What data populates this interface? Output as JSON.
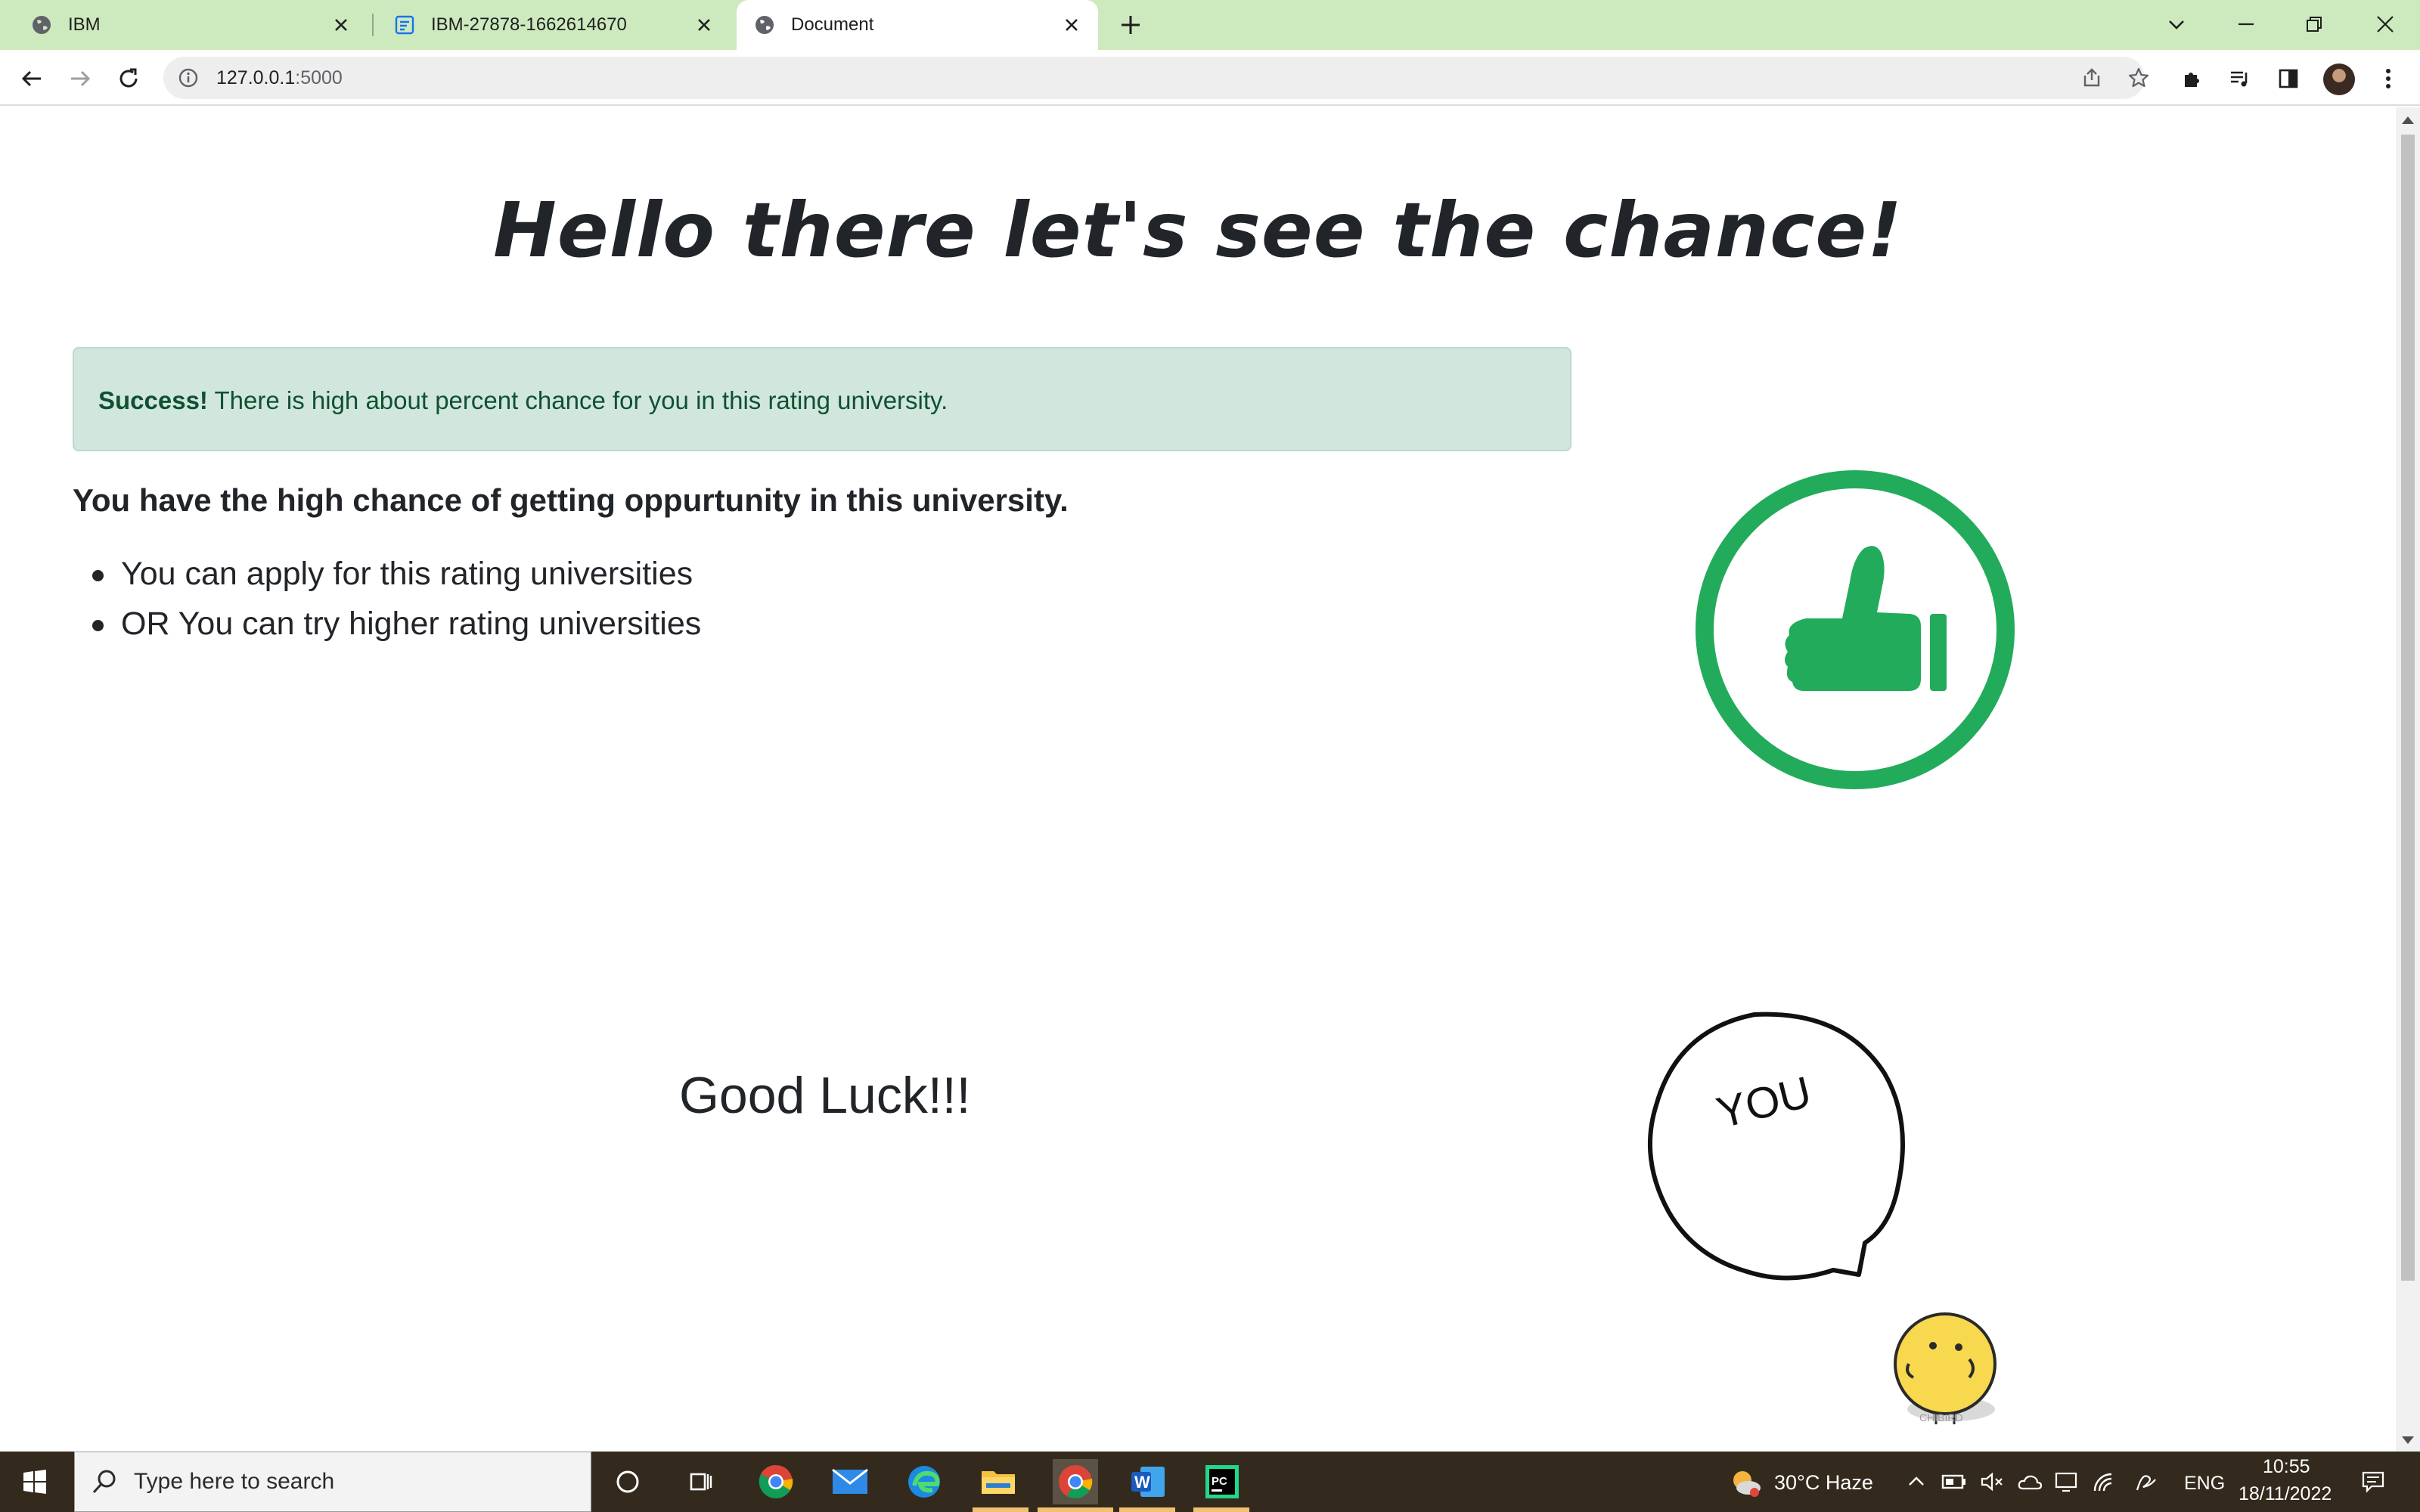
{
  "browser": {
    "tabs": [
      {
        "title": "IBM",
        "active": false
      },
      {
        "title": "IBM-27878-1662614670",
        "active": false
      },
      {
        "title": "Document",
        "active": true
      }
    ],
    "url_host": "127.0.0.1",
    "url_port": ":5000"
  },
  "page": {
    "heading": "Hello there let's see the chance!",
    "alert": {
      "strong": "Success!",
      "message": " There is high about percent chance for you in this rating university."
    },
    "subheading": "You have the high chance of getting oppurtunity in this university.",
    "bullets": [
      "You can apply for this rating universities",
      "OR You can try higher rating universities"
    ],
    "good_luck": "Good Luck!!!",
    "bubble_text": "YOU",
    "bird_label": "CHIBIRD",
    "accent_color": "#22ab5b",
    "alert_bg": "#d1e7dd"
  },
  "taskbar": {
    "search_placeholder": "Type here to search",
    "weather": "30°C  Haze",
    "language": "ENG",
    "time": "10:55",
    "date": "18/11/2022"
  }
}
